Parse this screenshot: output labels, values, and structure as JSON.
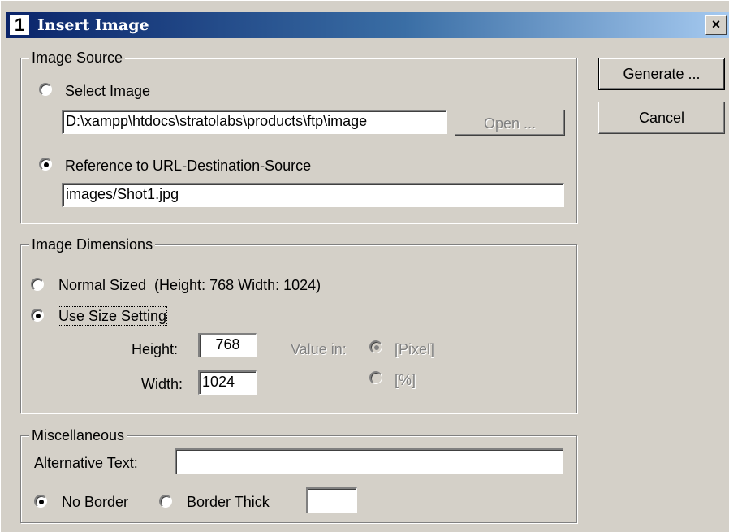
{
  "window": {
    "title": "Insert Image",
    "icon_label": "1",
    "close_label": "×"
  },
  "image_source": {
    "legend": "Image Source",
    "select_image_label": "Select Image",
    "file_path_value": "D:\\xampp\\htdocs\\stratolabs\\products\\ftp\\image",
    "open_button_label": "Open ...",
    "url_reference_label": "Reference to URL-Destination-Source",
    "url_value": "images/Shot1.jpg",
    "selected": "url"
  },
  "image_dimensions": {
    "legend": "Image Dimensions",
    "normal_sized_label": "Normal Sized  (Height: 768 Width: 1024)",
    "use_size_label": "Use Size Setting",
    "height_label": "Height:",
    "height_value": "768",
    "width_label": "Width:",
    "width_value": "1024",
    "value_in_label": "Value in:",
    "pixel_label": "[Pixel]",
    "percent_label": "[%]",
    "selected": "use_size"
  },
  "misc": {
    "legend": "Miscellaneous",
    "alt_text_label": "Alternative Text:",
    "alt_text_value": "",
    "no_border_label": "No Border",
    "border_thick_label": "Border Thick",
    "border_thick_value": "",
    "selected": "no_border"
  },
  "actions": {
    "generate_label": "Generate ...",
    "cancel_label": "Cancel"
  }
}
